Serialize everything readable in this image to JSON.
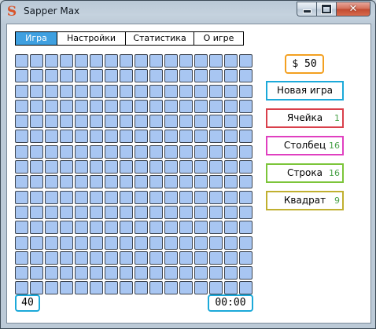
{
  "window": {
    "title": "Sapper Max",
    "app_icon": "S",
    "background_title": "Sapper Max",
    "controls": [
      "minimize",
      "maximize",
      "close"
    ]
  },
  "tabs": [
    {
      "label": "Игра",
      "active": true
    },
    {
      "label": "Настройки",
      "active": false
    },
    {
      "label": "Статистика",
      "active": false
    },
    {
      "label": "О игре",
      "active": false
    }
  ],
  "board": {
    "columns": 16,
    "rows": 16,
    "cell_color": "#a8c6f2"
  },
  "sidebar": {
    "money": "$ 50",
    "new_game": "Новая игра",
    "powerups": [
      {
        "label": "Ячейка",
        "count": "1",
        "color": "#d9404b"
      },
      {
        "label": "Столбец",
        "count": "16",
        "color": "#e040c0"
      },
      {
        "label": "Строка",
        "count": "16",
        "color": "#7cc53a"
      },
      {
        "label": "Квадрат",
        "count": "9",
        "color": "#c0b030"
      }
    ]
  },
  "footer": {
    "mines_left": "40",
    "timer": "00:00"
  },
  "colors": {
    "accent": "#3fa0e0",
    "money_border": "#f3a020",
    "new_game_border": "#1ca9d9",
    "count_text": "#4aa24a"
  }
}
